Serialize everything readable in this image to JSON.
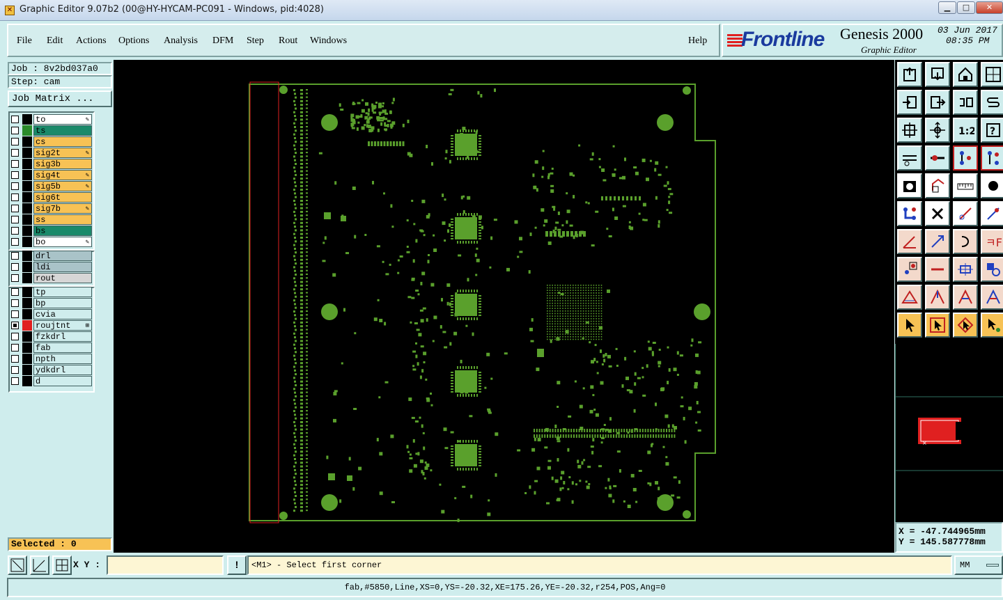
{
  "window": {
    "title": "Graphic Editor 9.07b2 (00@HY-HYCAM-PC091 - Windows, pid:4028)",
    "min_symbol": "▁",
    "max_symbol": "□",
    "close_symbol": "✕"
  },
  "menubar": {
    "items": [
      "File",
      "Edit",
      "Actions",
      "Options",
      "Analysis",
      "DFM",
      "Step",
      "Rout",
      "Windows"
    ],
    "help": "Help"
  },
  "branding": {
    "logo": "Frontline",
    "product": "Genesis 2000",
    "subtitle": "Graphic Editor",
    "date": "03 Jun 2017",
    "time": "08:35 PM"
  },
  "job": {
    "job_label": "Job : 8v2bd037a0",
    "step_label": "Step: cam",
    "matrix_button": "Job Matrix ..."
  },
  "layers": {
    "board": [
      {
        "name": "to",
        "color": "#ffffff",
        "swatch": "#000000",
        "editable": true
      },
      {
        "name": "ts",
        "color": "#1a8a6a",
        "swatch": "#2a8a2a",
        "editable": false
      },
      {
        "name": "cs",
        "color": "#f7c255",
        "swatch": "#000000",
        "editable": false
      },
      {
        "name": "sig2t",
        "color": "#f7c255",
        "swatch": "#000000",
        "editable": true
      },
      {
        "name": "sig3b",
        "color": "#f7c255",
        "swatch": "#000000",
        "editable": false
      },
      {
        "name": "sig4t",
        "color": "#f7c255",
        "swatch": "#000000",
        "editable": true
      },
      {
        "name": "sig5b",
        "color": "#f7c255",
        "swatch": "#000000",
        "editable": true
      },
      {
        "name": "sig6t",
        "color": "#f7c255",
        "swatch": "#000000",
        "editable": false
      },
      {
        "name": "sig7b",
        "color": "#f7c255",
        "swatch": "#000000",
        "editable": true
      },
      {
        "name": "ss",
        "color": "#f7c255",
        "swatch": "#000000",
        "editable": false
      },
      {
        "name": "bs",
        "color": "#1a8a6a",
        "swatch": "#000000",
        "editable": false
      },
      {
        "name": "bo",
        "color": "#ffffff",
        "swatch": "#000000",
        "editable": true
      }
    ],
    "drill": [
      {
        "name": "drl",
        "color": "#a9c3c8",
        "swatch": "#000000"
      },
      {
        "name": "ldi",
        "color": "#a9c3c8",
        "swatch": "#000000"
      },
      {
        "name": "rout",
        "color": "#d6d6d6",
        "swatch": "#000000"
      }
    ],
    "misc": [
      {
        "name": "tp",
        "color": "#cfeded",
        "swatch": "#000000",
        "checked": false
      },
      {
        "name": "bp",
        "color": "#cfeded",
        "swatch": "#000000",
        "checked": false
      },
      {
        "name": "cvia",
        "color": "#cfeded",
        "swatch": "#000000",
        "checked": false
      },
      {
        "name": "roujtnt",
        "color": "#cfeded",
        "swatch": "#e02020",
        "checked": true
      },
      {
        "name": "fzkdrl",
        "color": "#cfeded",
        "swatch": "#000000",
        "checked": false
      },
      {
        "name": "fab",
        "color": "#cfeded",
        "swatch": "#000000",
        "checked": false
      },
      {
        "name": "npth",
        "color": "#cfeded",
        "swatch": "#000000",
        "checked": false
      },
      {
        "name": "ydkdrl",
        "color": "#cfeded",
        "swatch": "#000000",
        "checked": false
      },
      {
        "name": "d",
        "color": "#cfeded",
        "swatch": "#000000",
        "checked": false
      }
    ]
  },
  "selected": "Selected : 0",
  "coords": {
    "x": "X = -47.744965mm",
    "y": "Y = 145.587778mm"
  },
  "bottom": {
    "xy_label": "X Y :",
    "xy_value": "",
    "alert_symbol": "!",
    "message": "<M1> - Select first corner",
    "units": "MM"
  },
  "status": "fab,#5850,Line,XS=0,YS=-20.32,XE=175.26,YE=-20.32,r254,POS,Ang=0",
  "colors": {
    "board_outline": "#5aa02c",
    "feature_green": "#5aa02c",
    "selection_red": "#e02020",
    "canvas_bg": "#000000"
  }
}
